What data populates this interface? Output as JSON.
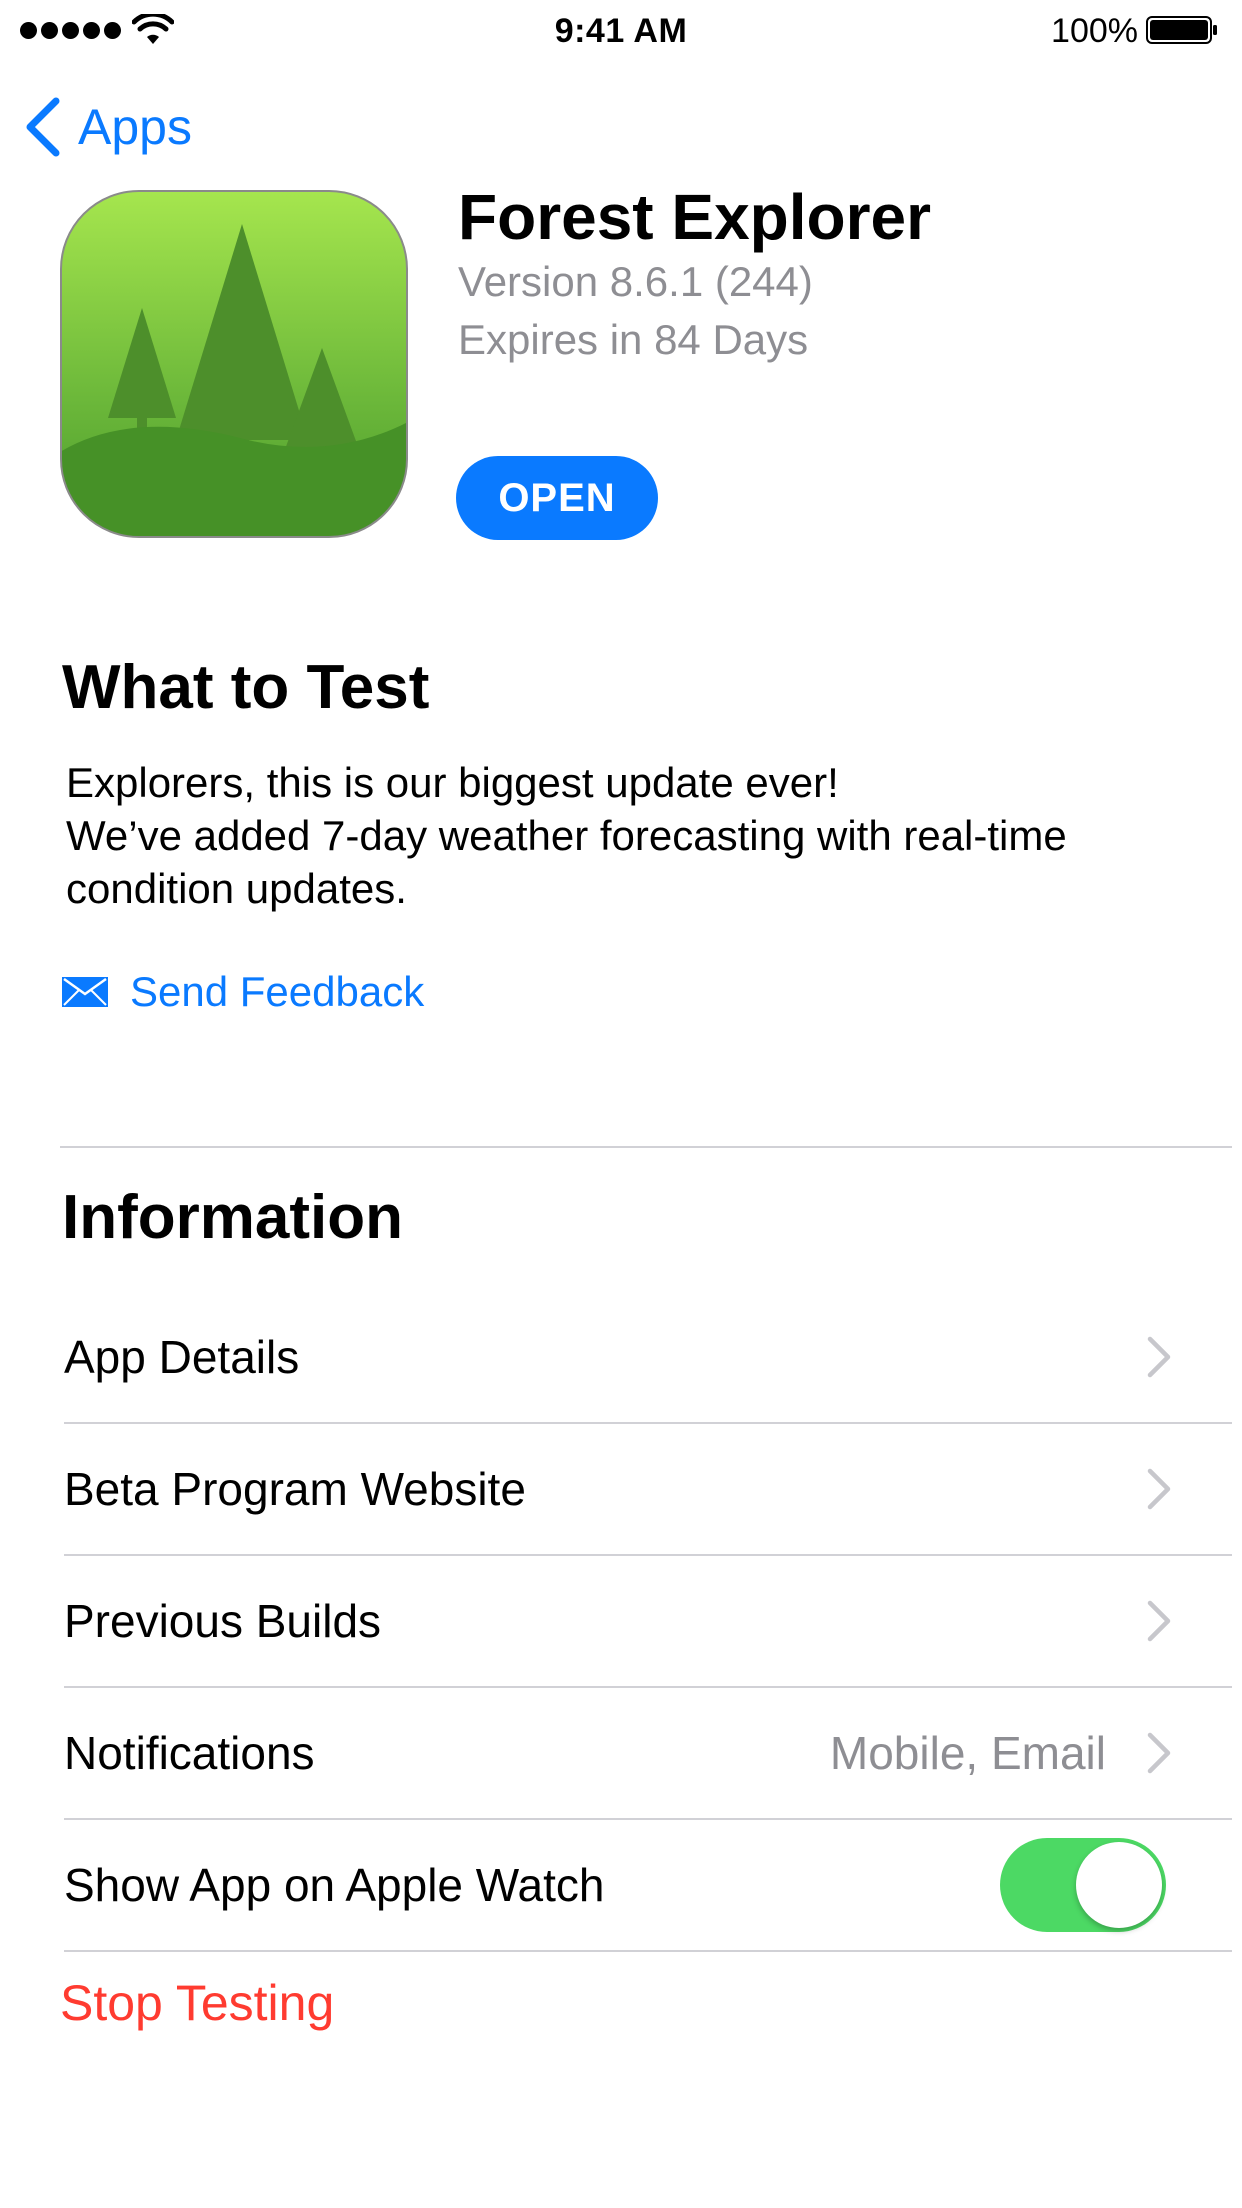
{
  "status_bar": {
    "time": "9:41 AM",
    "battery_percent": "100%",
    "signal_icon": "signal-dots-icon",
    "wifi_icon": "wifi-icon",
    "battery_icon": "battery-icon"
  },
  "nav": {
    "back_label": "Apps",
    "back_icon": "chevron-left-icon"
  },
  "app": {
    "name": "Forest Explorer",
    "version": "Version 8.6.1 (244)",
    "expiry": "Expires in 84 Days",
    "open_label": "OPEN",
    "icon": "forest-trees-app-icon"
  },
  "what_to_test": {
    "title": "What to Test",
    "lines": [
      "Explorers, this is our biggest update ever!",
      "We’ve added 7-day weather forecasting with real-time",
      "condition updates."
    ],
    "feedback_label": "Send Feedback",
    "feedback_icon": "envelope-icon"
  },
  "information": {
    "title": "Information",
    "rows": [
      {
        "label": "App Details",
        "value": ""
      },
      {
        "label": "Beta Program Website",
        "value": ""
      },
      {
        "label": "Previous Builds",
        "value": ""
      },
      {
        "label": "Notifications",
        "value": "Mobile, Email"
      },
      {
        "label": "Show App on Apple Watch",
        "toggle_on": true
      }
    ],
    "stop_label": "Stop Testing"
  },
  "colors": {
    "accent": "#0a7aff",
    "toggle_on": "#4cd964",
    "destructive": "#ff3b30",
    "secondary_text": "#8e8e93",
    "separator": "#d1d1d6"
  }
}
